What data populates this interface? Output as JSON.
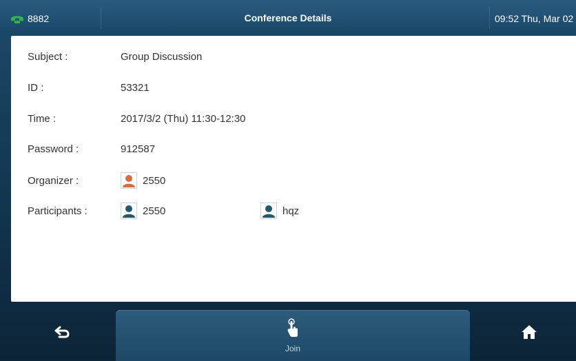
{
  "statusbar": {
    "line": "8882",
    "title": "Conference Details",
    "clock": "09:52 Thu, Mar 02"
  },
  "details": {
    "subject": {
      "label": "Subject :",
      "value": "Group Discussion"
    },
    "id": {
      "label": "ID :",
      "value": "53321"
    },
    "time": {
      "label": "Time :",
      "value": "2017/3/2 (Thu) 11:30-12:30"
    },
    "password": {
      "label": "Password :",
      "value": "912587"
    },
    "organizer": {
      "label": "Organizer :",
      "name": "2550"
    },
    "participants": {
      "label": "Participants :",
      "people": [
        "2550",
        "hqz"
      ]
    }
  },
  "softkeys": {
    "back_icon": "back-arrow-icon",
    "join_label": "Join",
    "join_icon": "hand-tap-icon",
    "home_icon": "home-icon"
  },
  "colors": {
    "accent_bar": "#184566",
    "organizer_avatar": "#e06a3c",
    "participant_avatar": "#1f5a6e",
    "phone_green": "#2fb34a"
  }
}
